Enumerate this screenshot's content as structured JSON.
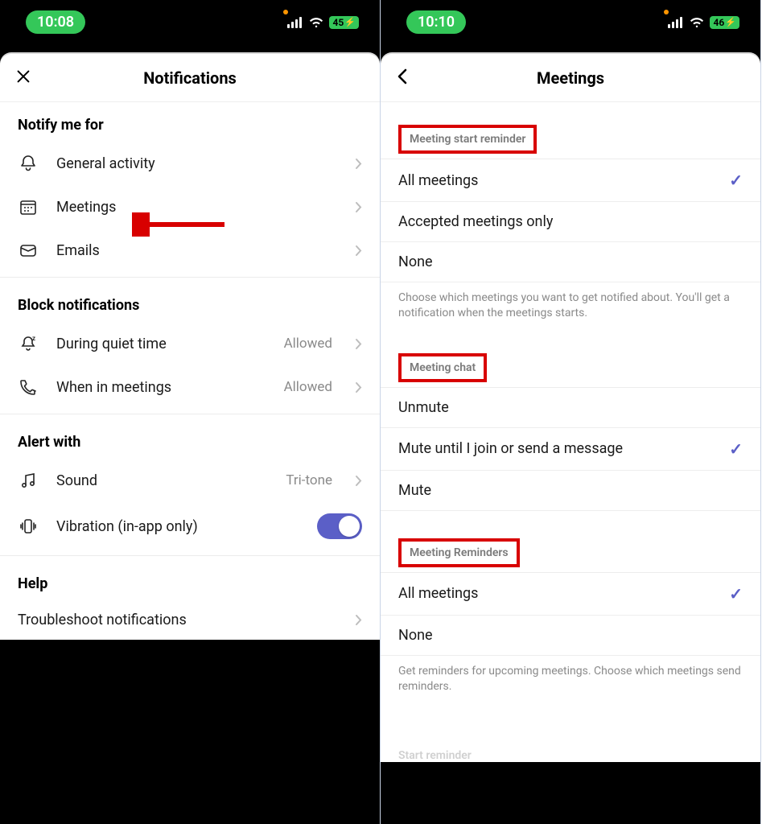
{
  "left": {
    "status": {
      "time": "10:08",
      "battery": "45"
    },
    "header": {
      "title": "Notifications"
    },
    "sections": {
      "notify_me_for": {
        "title": "Notify me for",
        "items": {
          "general_activity": "General activity",
          "meetings": "Meetings",
          "emails": "Emails"
        }
      },
      "block": {
        "title": "Block notifications",
        "items": {
          "quiet_time": {
            "label": "During quiet time",
            "value": "Allowed"
          },
          "in_meetings": {
            "label": "When in meetings",
            "value": "Allowed"
          }
        }
      },
      "alert": {
        "title": "Alert with",
        "items": {
          "sound": {
            "label": "Sound",
            "value": "Tri-tone"
          },
          "vibration": {
            "label": "Vibration (in-app only)"
          }
        }
      },
      "help": {
        "title": "Help",
        "items": {
          "troubleshoot": "Troubleshoot notifications"
        }
      }
    }
  },
  "right": {
    "status": {
      "time": "10:10",
      "battery": "46"
    },
    "header": {
      "title": "Meetings"
    },
    "groups": {
      "start_reminder": {
        "title": "Meeting start reminder",
        "options": {
          "all": "All meetings",
          "accepted": "Accepted meetings only",
          "none": "None"
        },
        "help": "Choose which meetings you want to get notified about. You'll get a notification when the meetings starts."
      },
      "chat": {
        "title": "Meeting chat",
        "options": {
          "unmute": "Unmute",
          "mute_until": "Mute until I join or send a message",
          "mute": "Mute"
        }
      },
      "reminders": {
        "title": "Meeting Reminders",
        "options": {
          "all": "All meetings",
          "none": "None"
        },
        "help": "Get reminders for upcoming meetings. Choose which meetings send reminders."
      },
      "cutoff": "Start reminder"
    }
  }
}
